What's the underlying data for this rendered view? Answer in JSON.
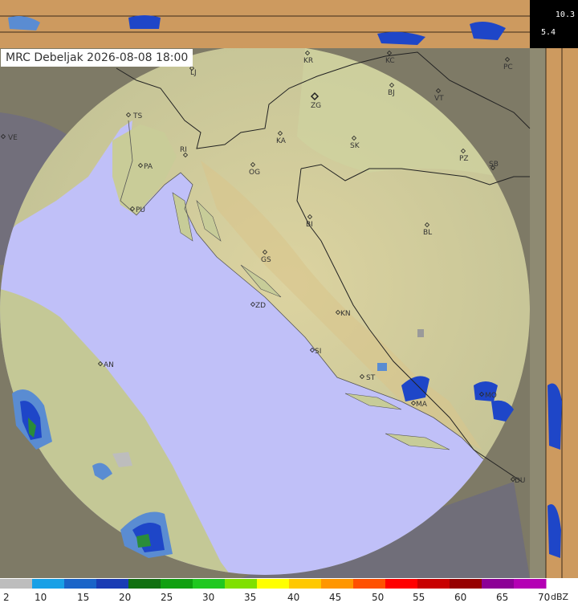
{
  "header": {
    "title": "MRC Debeljak  2026-08-08  18:00"
  },
  "side_panel": {
    "value_1": "10.3",
    "value_2": "5.4"
  },
  "cities": [
    {
      "code": "LJ"
    },
    {
      "code": "KR"
    },
    {
      "code": "KC"
    },
    {
      "code": "PC"
    },
    {
      "code": "TS"
    },
    {
      "code": "ZG"
    },
    {
      "code": "BJ"
    },
    {
      "code": "VT"
    },
    {
      "code": "VE"
    },
    {
      "code": "KA"
    },
    {
      "code": "SK"
    },
    {
      "code": "RI"
    },
    {
      "code": "PA"
    },
    {
      "code": "OG"
    },
    {
      "code": "PZ"
    },
    {
      "code": "SB"
    },
    {
      "code": "PU"
    },
    {
      "code": "BI"
    },
    {
      "code": "BL"
    },
    {
      "code": "GS"
    },
    {
      "code": "ZD"
    },
    {
      "code": "KN"
    },
    {
      "code": "AN"
    },
    {
      "code": "SI"
    },
    {
      "code": "ST"
    },
    {
      "code": "MO"
    },
    {
      "code": "MA"
    },
    {
      "code": "DU"
    }
  ],
  "legend": {
    "unit": "dBZ",
    "labels": [
      "2",
      "10",
      "15",
      "20",
      "25",
      "30",
      "35",
      "40",
      "45",
      "50",
      "55",
      "60",
      "65",
      "70"
    ],
    "colors": [
      "#bdbdbd",
      "#19a0e6",
      "#1a64c8",
      "#1a3cb4",
      "#107010",
      "#10a010",
      "#20c820",
      "#80e000",
      "#ffff00",
      "#ffc800",
      "#ff9600",
      "#ff5000",
      "#ff0000",
      "#c80000",
      "#960000",
      "#8c0096",
      "#b400b4"
    ],
    "colors_note": ""
  },
  "colors": {
    "radar_disc": "#c0c0f8",
    "land": "#c8c08c",
    "outside": "#8a8478",
    "strip": "#cd9a5f",
    "echo_light": "#5a8cd2",
    "echo_mid": "#1e46c8",
    "echo_core": "#2a8c3a"
  }
}
